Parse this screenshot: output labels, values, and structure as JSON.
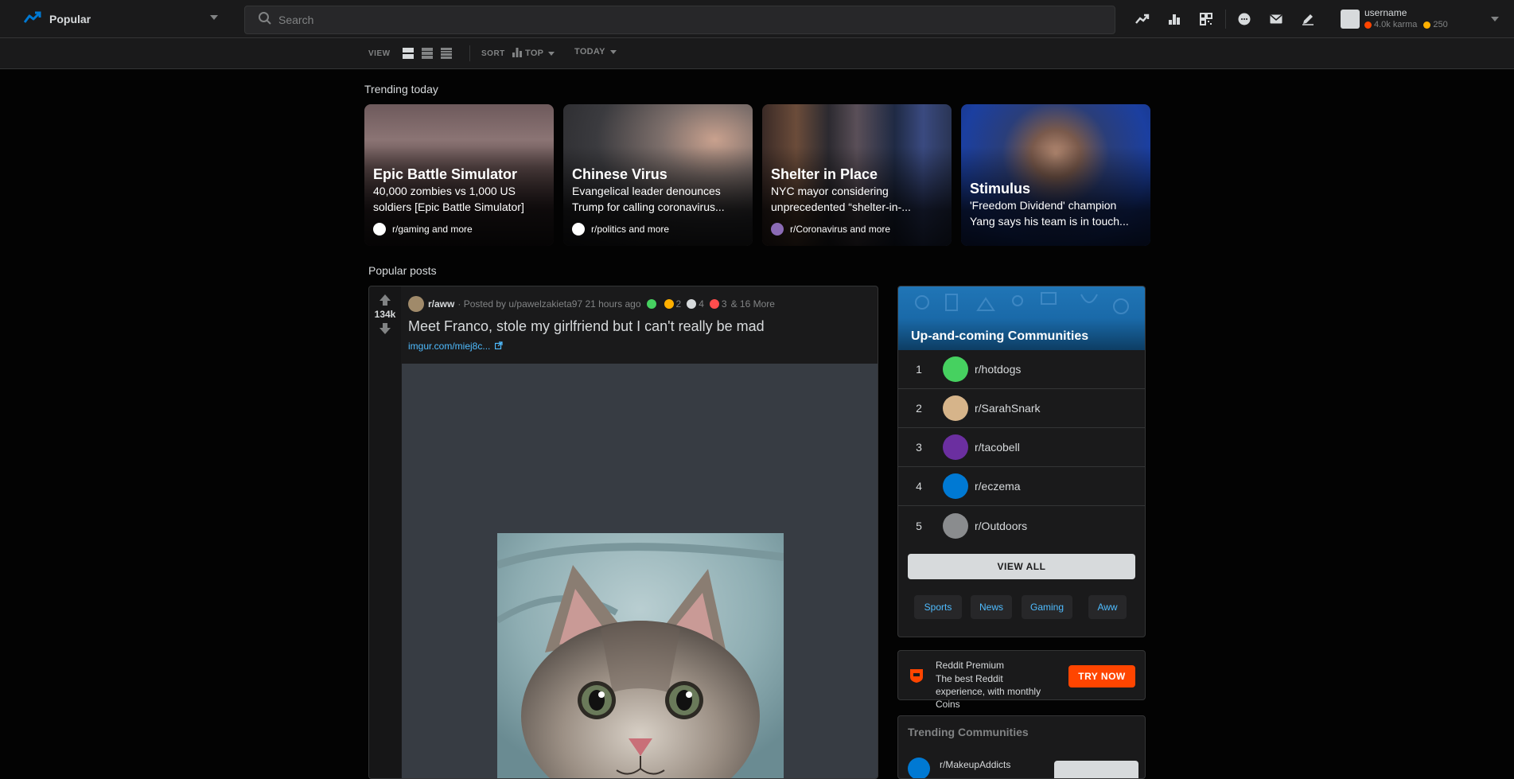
{
  "header": {
    "home_label": "Popular",
    "search_placeholder": "Search",
    "username": "username",
    "karma": "4.0k karma",
    "coins": "250"
  },
  "subbar": {
    "view_label": "VIEW",
    "sort_label": "SORT",
    "sort_value": "TOP",
    "time_value": "TODAY"
  },
  "trending": {
    "title": "Trending today",
    "cards": [
      {
        "title": "Epic Battle Simulator",
        "desc": "40,000 zombies vs 1,000 US soldiers [Epic Battle Simulator]",
        "sub": "r/gaming and more"
      },
      {
        "title": "Chinese Virus",
        "desc": "Evangelical leader denounces Trump for calling coronavirus...",
        "sub": "r/politics and more"
      },
      {
        "title": "Shelter in Place",
        "desc": "NYC mayor considering unprecedented “shelter-in-...",
        "sub": "r/Coronavirus and more"
      },
      {
        "title": "Stimulus",
        "desc": "'Freedom Dividend' champion Yang says his team is in touch...",
        "sub": ""
      }
    ]
  },
  "popular": {
    "title": "Popular posts"
  },
  "post": {
    "score": "134k",
    "subreddit": "r/aww",
    "posted_by": "· Posted by u/pawelzakieta97 21 hours ago",
    "award1_count": "2",
    "award2_count": "4",
    "award3_count": "3",
    "more_awards": "& 16 More",
    "title": "Meet Franco, stole my girlfriend but I can't really be mad",
    "link": "imgur.com/miej8c..."
  },
  "upcoming": {
    "title": "Up-and-coming Communities",
    "items": [
      {
        "rank": "1",
        "name": "r/hotdogs"
      },
      {
        "rank": "2",
        "name": "r/SarahSnark"
      },
      {
        "rank": "3",
        "name": "r/tacobell"
      },
      {
        "rank": "4",
        "name": "r/eczema"
      },
      {
        "rank": "5",
        "name": "r/Outdoors"
      }
    ],
    "view_all": "VIEW ALL",
    "pills": [
      "Sports",
      "News",
      "Gaming",
      "Aww"
    ]
  },
  "premium": {
    "title": "Reddit Premium",
    "desc": "The best Reddit experience, with monthly Coins",
    "button": "TRY NOW"
  },
  "trending_communities": {
    "title": "Trending Communities",
    "first": "r/MakeupAddicts"
  },
  "colors": {
    "accent": "#0079d3",
    "orange": "#ff4500",
    "link": "#4fbcff"
  }
}
